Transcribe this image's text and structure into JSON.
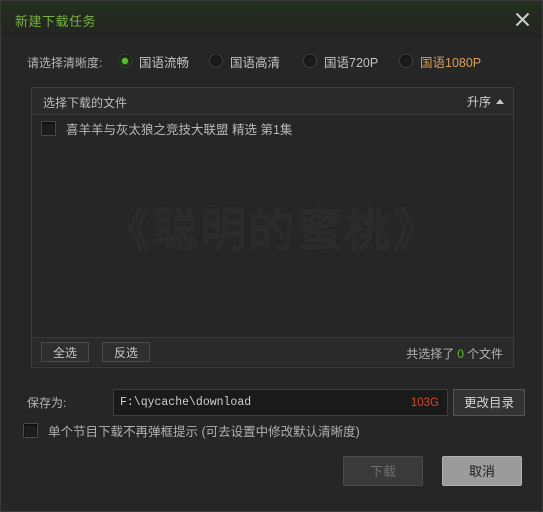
{
  "titlebar": {
    "title": "新建下载任务",
    "close_icon": "close-icon"
  },
  "quality": {
    "label": "请选择清晰度:",
    "options": [
      {
        "label": "国语流畅",
        "selected": true,
        "highlight": false
      },
      {
        "label": "国语高清",
        "selected": false,
        "highlight": false
      },
      {
        "label": "国语720P",
        "selected": false,
        "highlight": false
      },
      {
        "label": "国语1080P",
        "selected": false,
        "highlight": true
      }
    ]
  },
  "file_list": {
    "header_title": "选择下载的文件",
    "sort_label": "升序",
    "sort_direction": "ascending",
    "watermark": "《聪明的蜜桃》",
    "items": [
      {
        "name": "喜羊羊与灰太狼之竞技大联盟 精选 第1集",
        "checked": false
      }
    ],
    "select_all_label": "全选",
    "invert_label": "反选",
    "count_prefix": "共选择了",
    "count_value": "0",
    "count_suffix": "个文件"
  },
  "save": {
    "label": "保存为:",
    "path": "F:\\qycache\\download",
    "free_space": "103G",
    "change_dir_label": "更改目录"
  },
  "remember": {
    "label": "单个节目下载不再弹框提示 (可去设置中修改默认清晰度)",
    "checked": false
  },
  "footer": {
    "download_label": "下载",
    "download_disabled": true,
    "cancel_label": "取消"
  },
  "colors": {
    "title_green": "#76b03c",
    "accent_gold": "#d2a055",
    "size_red": "#d2492b",
    "count_green": "#6ab92e",
    "dialog_bg": "#262626"
  }
}
